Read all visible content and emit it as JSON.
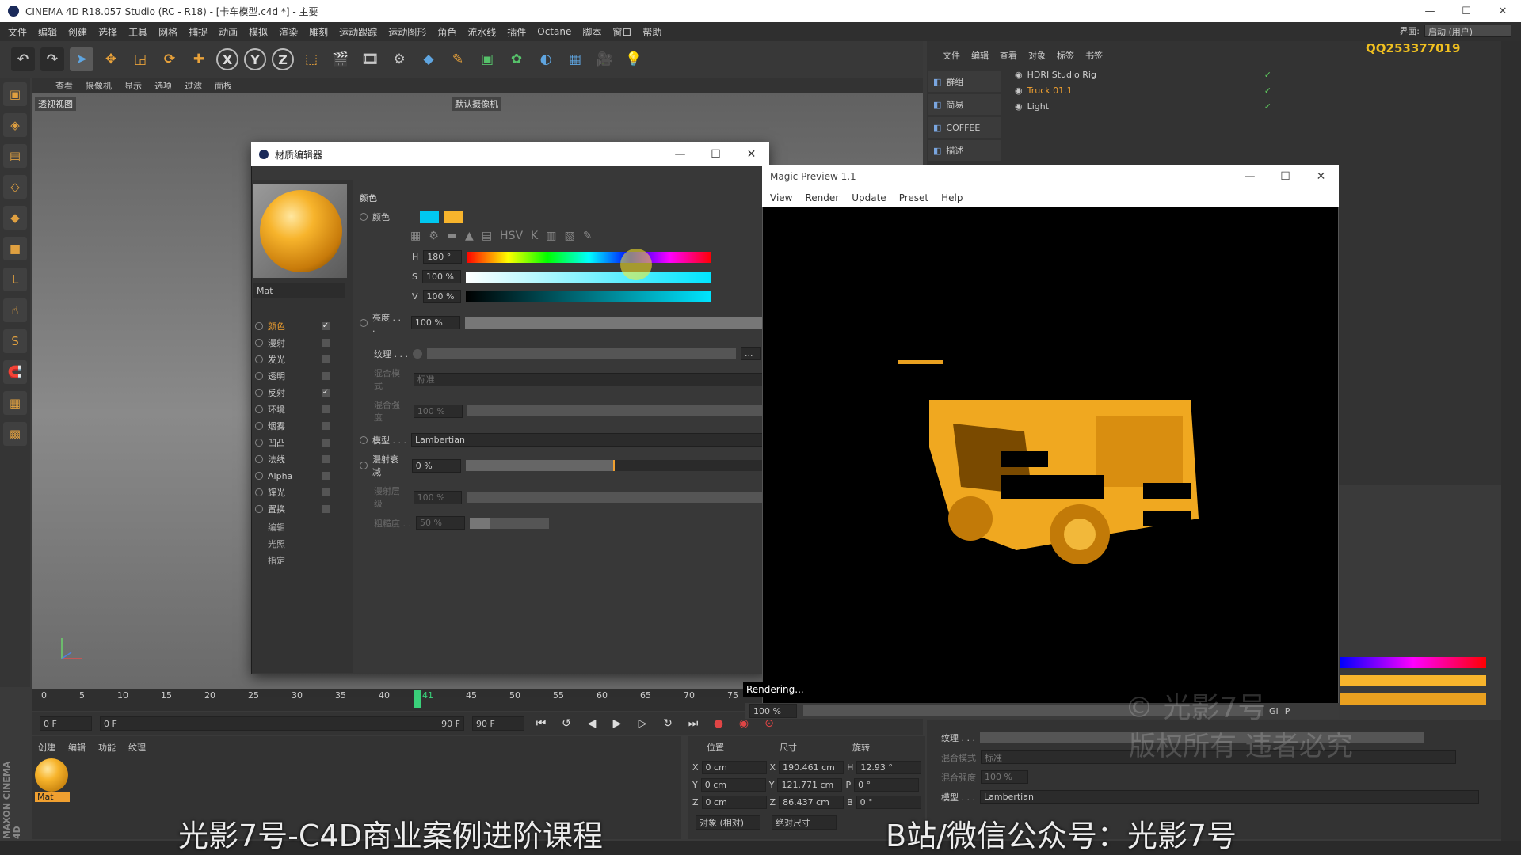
{
  "app": {
    "title": "CINEMA 4D R18.057 Studio (RC - R18) - [卡车模型.c4d *] - 主要",
    "menu": [
      "文件",
      "编辑",
      "创建",
      "选择",
      "工具",
      "网格",
      "捕捉",
      "动画",
      "模拟",
      "渲染",
      "雕刻",
      "运动跟踪",
      "运动图形",
      "角色",
      "流水线",
      "插件",
      "Octane",
      "脚本",
      "窗口",
      "帮助"
    ],
    "layout_label": "界面:",
    "layout_value": "启动 (用户)"
  },
  "toolbar": {
    "icons": [
      "undo-icon",
      "redo-icon",
      "select-icon",
      "move-icon",
      "scale-icon",
      "rotate-icon",
      "add-icon",
      "x-axis",
      "y-axis",
      "z-axis",
      "coord-system-icon",
      "render-view-icon",
      "render-picture-icon",
      "render-settings-icon",
      "cube-icon",
      "pen-icon",
      "subdiv-icon",
      "cloner-icon",
      "deformer-icon",
      "floor-icon",
      "camera-icon",
      "light-icon"
    ],
    "axis_x": "X",
    "axis_y": "Y",
    "axis_z": "Z"
  },
  "viewport": {
    "menu": [
      "查看",
      "摄像机",
      "显示",
      "选项",
      "过滤",
      "面板"
    ],
    "label": "透视视图",
    "camera": "默认摄像机"
  },
  "object_manager": {
    "menu": [
      "文件",
      "编辑",
      "查看",
      "对象",
      "标签",
      "书签"
    ],
    "qq": "QQ253377019",
    "layers": [
      "群组",
      "简易",
      "COFFEE",
      "描述"
    ],
    "objects": [
      {
        "name": "HDRI Studio Rig",
        "color": "#cfcfcf"
      },
      {
        "name": "Truck 01.1",
        "color": "#f0a030"
      },
      {
        "name": "Light",
        "color": "#cfcfcf"
      }
    ]
  },
  "material_editor": {
    "title": "材质编辑器",
    "mat_name": "Mat",
    "channels": [
      {
        "label": "颜色",
        "checked": true,
        "active": true
      },
      {
        "label": "漫射",
        "checked": false
      },
      {
        "label": "发光",
        "checked": false
      },
      {
        "label": "透明",
        "checked": false
      },
      {
        "label": "反射",
        "checked": true
      },
      {
        "label": "环境",
        "checked": false
      },
      {
        "label": "烟雾",
        "checked": false
      },
      {
        "label": "凹凸",
        "checked": false
      },
      {
        "label": "法线",
        "checked": false
      },
      {
        "label": "Alpha",
        "checked": false
      },
      {
        "label": "辉光",
        "checked": false
      },
      {
        "label": "置换",
        "checked": false
      }
    ],
    "sub_items": [
      "编辑",
      "光照",
      "指定"
    ],
    "section_title": "颜色",
    "color_label": "颜色",
    "swatch_color": "#00c8f0",
    "swatch_color2": "#f7b42c",
    "h_label": "H",
    "h_value": "180 °",
    "h_fraction": 0.5,
    "s_label": "S",
    "s_value": "100 %",
    "s_fraction": 1.0,
    "v_label": "V",
    "v_value": "100 %",
    "v_fraction": 1.0,
    "brightness_label": "亮度 . . .",
    "brightness_value": "100 %",
    "brightness_fraction": 1.0,
    "texture_label": "纹理 . . .",
    "blend_mode_label": "混合模式",
    "blend_mode_value": "标准",
    "blend_strength_label": "混合强度",
    "blend_strength_value": "100 %",
    "model_label": "模型 . . .",
    "model_value": "Lambertian",
    "diffuse_falloff_label": "漫射衰减",
    "diffuse_falloff_value": "0 %",
    "diffuse_falloff_fraction": 0.5,
    "diffuse_level_label": "漫射层级",
    "diffuse_level_value": "100 %",
    "roughness_label": "粗糙度 . .",
    "roughness_value": "50 %",
    "roughness_fraction": 0.25
  },
  "magic_preview": {
    "title": "Magic Preview 1.1",
    "menu": [
      "View",
      "Render",
      "Update",
      "Preset",
      "Help"
    ],
    "status": "Rendering...",
    "zoom": "100 %",
    "gi": "GI",
    "p": "P"
  },
  "timeline": {
    "ticks": [
      "0",
      "5",
      "10",
      "15",
      "20",
      "25",
      "30",
      "35",
      "40",
      "41",
      "45",
      "50",
      "55",
      "60",
      "65",
      "70",
      "75"
    ],
    "current_frame": "41",
    "start_field": "0 F",
    "range_start": "0 F",
    "range_end": "90 F",
    "end_field": "90 F"
  },
  "material_manager": {
    "menu": [
      "创建",
      "编辑",
      "功能",
      "纹理"
    ],
    "mat_label": "Mat"
  },
  "coordinates": {
    "headers": [
      "位置",
      "尺寸",
      "旋转"
    ],
    "rows": [
      {
        "axis": "X",
        "pos": "0 cm",
        "size_axis": "X",
        "size": "190.461 cm",
        "rot_axis": "H",
        "rot": "12.93 °"
      },
      {
        "axis": "Y",
        "pos": "0 cm",
        "size_axis": "Y",
        "size": "121.771 cm",
        "rot_axis": "P",
        "rot": "0 °"
      },
      {
        "axis": "Z",
        "pos": "0 cm",
        "size_axis": "Z",
        "size": "86.437 cm",
        "rot_axis": "B",
        "rot": "0 °"
      }
    ],
    "mode1": "对象 (相对)",
    "mode2": "绝对尺寸"
  },
  "attributes_bottom": {
    "texture_label": "纹理 . . .",
    "blend_mode_label": "混合模式",
    "blend_mode_value": "标准",
    "blend_strength_label": "混合强度",
    "blend_strength_value": "100 %",
    "model_label": "模型 . . .",
    "model_value": "Lambertian"
  },
  "overlay": {
    "watermark_1": "© 光影7号",
    "watermark_2": "版权所有 违者必究",
    "subtitle_left": "光影7号-C4D商业案例进阶课程",
    "subtitle_right": "B站/微信公众号：光影7号",
    "maxon": "MAXON CINEMA 4D"
  }
}
